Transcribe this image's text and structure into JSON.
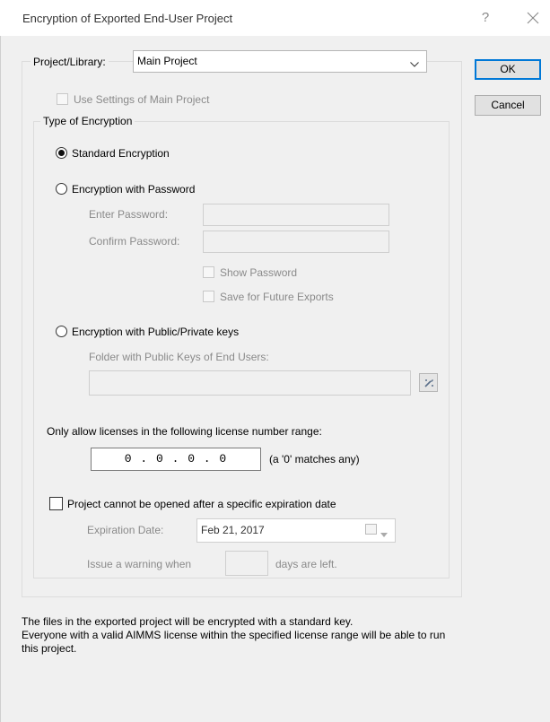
{
  "window": {
    "title": "Encryption of Exported End-User Project",
    "help_glyph": "?"
  },
  "buttons": {
    "ok": "OK",
    "cancel": "Cancel"
  },
  "project_library": {
    "label": "Project/Library:",
    "selected": "Main Project"
  },
  "use_settings": {
    "label": "Use Settings of Main Project",
    "checked": false,
    "enabled": false
  },
  "encryption_type": {
    "legend": "Type of Encryption",
    "standard": {
      "label": "Standard Encryption",
      "selected": true
    },
    "password": {
      "label": "Encryption with Password",
      "selected": false,
      "enter_label": "Enter Password:",
      "confirm_label": "Confirm Password:",
      "enter_value": "",
      "confirm_value": "",
      "show_password_label": "Show Password",
      "save_future_label": "Save for Future Exports"
    },
    "keys": {
      "label": "Encryption with Public/Private keys",
      "selected": false,
      "folder_label": "Folder with Public Keys of End Users:",
      "folder_value": ""
    }
  },
  "license_range": {
    "label": "Only allow licenses in the following license number range:",
    "value": "0 . 0 . 0 . 0",
    "hint": "(a '0' matches any)"
  },
  "expiration": {
    "checkbox_label": "Project cannot be opened after a specific expiration date",
    "checked": false,
    "date_label": "Expiration Date:",
    "date_value": "Feb 21, 2017",
    "warn_prefix": "Issue a warning when",
    "warn_days": "",
    "warn_suffix": "days are left."
  },
  "footer": {
    "line1": "The files in the exported project will be encrypted with a standard key.",
    "line2": "Everyone with a valid AIMMS license within the specified license range will be able to run",
    "line3": "this project."
  },
  "colors": {
    "accent": "#0078d7",
    "disabled_text": "#8a8a8a",
    "background": "#f0f0f0"
  },
  "icons": {
    "close": "close-icon",
    "dropdown": "chevron-down-icon",
    "browse": "folder-browse-icon",
    "calendar": "calendar-icon"
  }
}
